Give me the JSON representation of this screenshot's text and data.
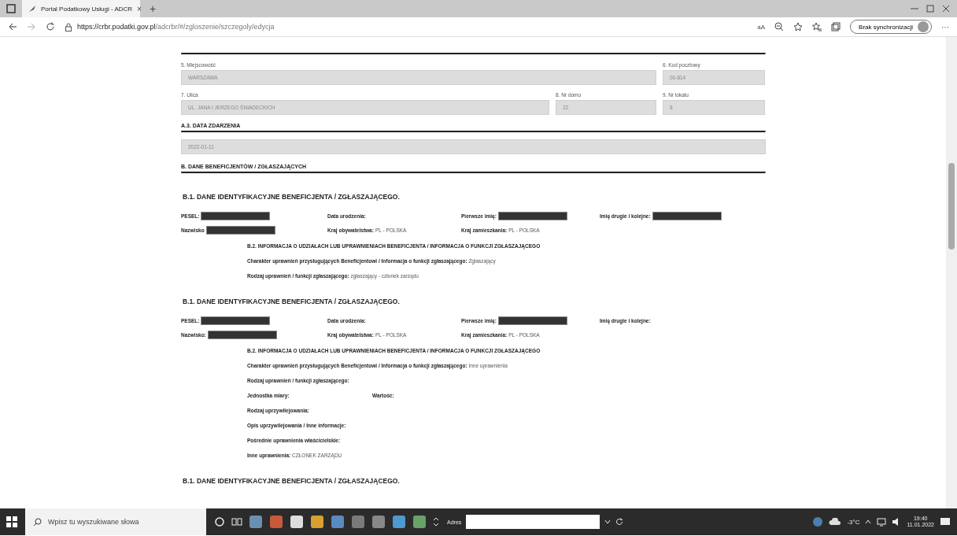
{
  "browser": {
    "tab_title": "Portal Podatkowy Usługi - ADCR",
    "tab_close": "×",
    "new_tab": "+",
    "url_host": "https://crbr.podatki.gov.pl",
    "url_path": "/adcrbr/#/zgloszenie/szczegoly/edycja",
    "read_aloud": "aA",
    "sync_button": "Brak synchronizacji",
    "more": "···"
  },
  "address_rows": [
    {
      "fields": [
        {
          "label": "5. Miejscowość",
          "value": "WARSZAWA"
        },
        {
          "label": "6. Kod pocztowy",
          "value": "00-814"
        }
      ]
    },
    {
      "fields": [
        {
          "label": "7. Ulica",
          "value": "UL. JANA I JERZEGO ŚNIADECKICH"
        },
        {
          "label": "8. Nr domu",
          "value": "22"
        },
        {
          "label": "9. Nr lokalu",
          "value": "8"
        }
      ]
    }
  ],
  "event_date": {
    "heading": "A.3. DATA ZDARZENIA",
    "value": "2022-01-11"
  },
  "beneficiaries_heading": "B. DANE BENEFICJENTÓW / ZGŁASZAJĄCYCH",
  "beneficiaries": [
    {
      "heading": "B.1. DANE IDENTYFIKACYJNE BENEFICJENTA / ZGŁASZAJĄCEGO.",
      "fields": [
        {
          "label": "PESEL:",
          "redacted": true
        },
        {
          "label": "Data urodzenia:",
          "redacted": false
        },
        {
          "label": "Pierwsze imię:",
          "redacted": true
        },
        {
          "label": "Imię drugie i kolejne:",
          "redacted": true
        },
        {
          "label": "Nazwisko",
          "redacted": true
        },
        {
          "label": "Kraj obywatelstwa:",
          "value": "PL - POLSKA",
          "redacted": false
        },
        {
          "label": "Kraj zamieszkania:",
          "value": "PL - POLSKA",
          "redacted": false
        }
      ],
      "sub_heading": "B.2. INFORMACJA O UDZIAŁACH LUB UPRAWNIENIACH BENEFICJENTA / INFORMACJA O FUNKCJI ZGŁASZAJĄCEGO",
      "details": [
        {
          "fields": [
            {
              "label": "Charakter uprawnień przysługujących Beneficjentowi / Informacja o funkcji zgłaszającego:",
              "value": "Zgłaszający"
            }
          ]
        },
        {
          "fields": [
            {
              "label": "Rodzaj uprawnień / funkcji zgłaszającego:",
              "value": "zgłaszający - członek zarządu"
            }
          ]
        }
      ]
    },
    {
      "heading": "B.1. DANE IDENTYFIKACYJNE BENEFICJENTA / ZGŁASZAJĄCEGO.",
      "fields": [
        {
          "label": "PESEL:",
          "redacted": true
        },
        {
          "label": "Data urodzenia:",
          "redacted": false
        },
        {
          "label": "Pierwsze imię:",
          "redacted": true
        },
        {
          "label": "Imię drugie i kolejne:",
          "redacted": false
        },
        {
          "label": "Nazwisko:",
          "redacted": true
        },
        {
          "label": "Kraj obywatelstwa:",
          "value": "PL - POLSKA",
          "redacted": false
        },
        {
          "label": "Kraj zamieszkania:",
          "value": "PL - POLSKA",
          "redacted": false
        }
      ],
      "sub_heading": "B.2. INFORMACJA O UDZIAŁACH LUB UPRAWNIENIACH BENEFICJENTA / INFORMACJA O FUNKCJI ZGŁASZAJĄCEGO",
      "details": [
        {
          "fields": [
            {
              "label": "Charakter uprawnień przysługujących Beneficjentowi / Informacja o funkcji zgłaszającego:",
              "value": "Inne uprawnienia"
            }
          ]
        },
        {
          "fields": [
            {
              "label": "Rodzaj uprawnień / funkcji zgłaszającego:"
            }
          ]
        },
        {
          "fields": [
            {
              "label": "Jednostka miary:"
            },
            {
              "label": "Wartość:"
            }
          ]
        },
        {
          "fields": [
            {
              "label": "Rodzaj uprzywilejowania:"
            }
          ]
        },
        {
          "fields": [
            {
              "label": "Opis uprzywilejowania / Inne informacje:"
            }
          ]
        },
        {
          "fields": [
            {
              "label": "Pośrednie uprawnienia właścicielskie:"
            }
          ]
        },
        {
          "fields": [
            {
              "label": "Inne uprawnienia:",
              "value": "CZŁONEK ZARZĄDU"
            }
          ]
        }
      ]
    },
    {
      "heading": "B.1. DANE IDENTYFIKACYJNE BENEFICJENTA / ZGŁASZAJĄCEGO."
    }
  ],
  "taskbar": {
    "search_placeholder": "Wpisz tu wyszukiwane słowa",
    "address_label": "Adres",
    "temperature": "-3°C",
    "time": "19:40",
    "date": "11.01.2022"
  }
}
